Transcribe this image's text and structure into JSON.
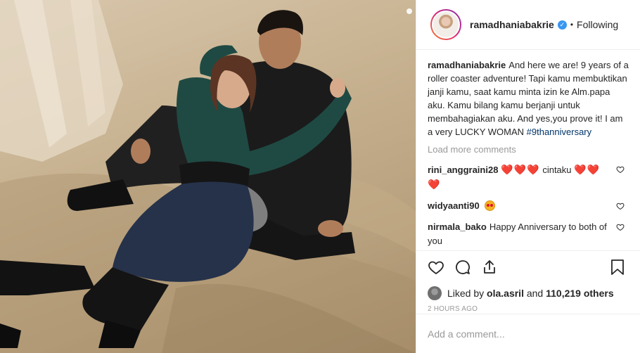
{
  "post": {
    "author": {
      "username": "ramadhaniabakrie",
      "verified": true,
      "follow_state": "Following"
    },
    "caption": {
      "username": "ramadhaniabakrie",
      "text": "And here we are! 9 years of a roller coaster adventure! Tapi kamu membuktikan janji kamu, saat kamu minta izin ke Alm.papa aku. Kamu bilang kamu berjanji untuk membahagiakan aku. And yes,you prove it! I am a very LUCKY WOMAN",
      "hashtag": "#9thanniversary"
    },
    "load_more_label": "Load more comments",
    "comments": [
      {
        "username": "rini_anggraini28",
        "text_before": "❤️❤️❤️",
        "text": " cintaku ",
        "text_after": "❤️❤️❤️"
      },
      {
        "username": "widyaanti90",
        "text": ""
      },
      {
        "username": "nirmala_bako",
        "text": "Happy Anniversary to both of you"
      }
    ],
    "likes": {
      "prefix": "Liked by",
      "first_user": "ola.asril",
      "connector": "and",
      "others": "110,219 others"
    },
    "timestamp": "2 HOURS AGO",
    "add_comment_placeholder": "Add a comment..."
  },
  "icons": {
    "like": "heart-icon",
    "comment": "comment-icon",
    "share": "share-icon",
    "save": "bookmark-icon",
    "verified": "verified-badge-icon"
  },
  "colors": {
    "accent": "#3897f0",
    "hashtag": "#003569",
    "muted": "#999999",
    "heart": "#e0122c"
  }
}
